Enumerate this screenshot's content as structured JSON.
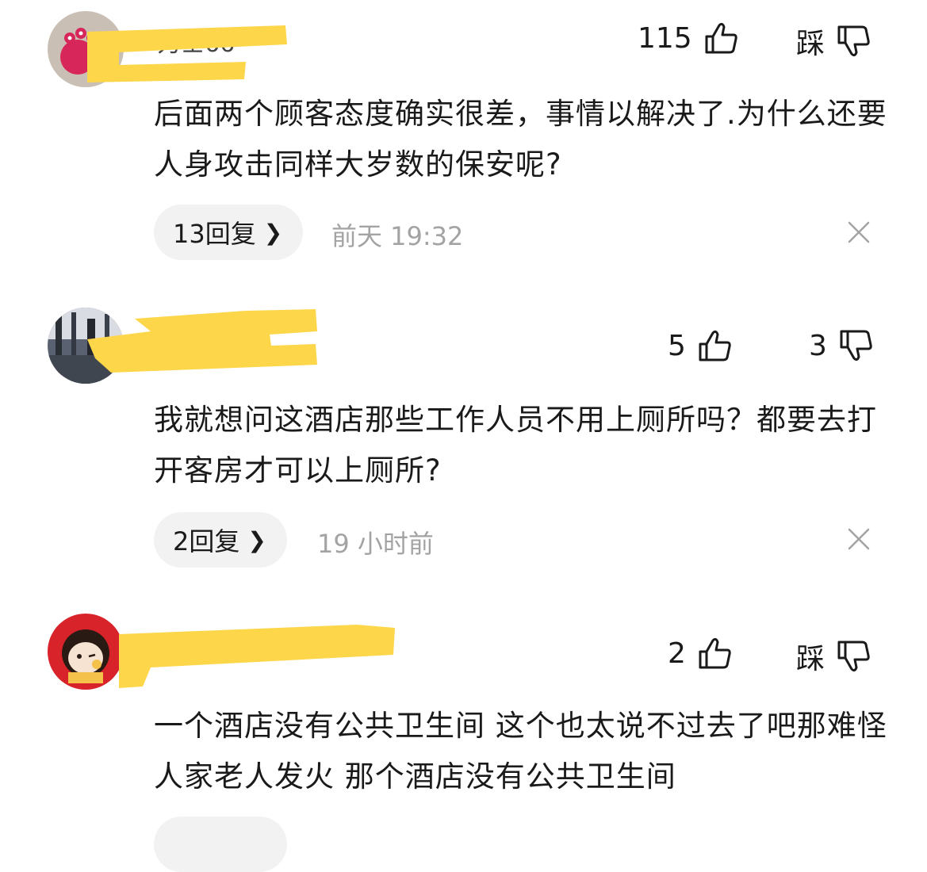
{
  "comments": [
    {
      "username": "力士66",
      "likes": "115",
      "dislike": "踩",
      "text": "后面两个顾客态度确实很差，事情以解决了.为什么还要人身攻击同样大岁数的保安呢?",
      "replies": "13回复",
      "time": "前天 19:32"
    },
    {
      "username": "",
      "likes": "5",
      "dislike": "3",
      "text": "我就想问这酒店那些工作人员不用上厕所吗？都要去打开客房才可以上厕所?",
      "replies": "2回复",
      "time": "19 小时前"
    },
    {
      "username": "",
      "likes": "2",
      "dislike": "踩",
      "text": "一个酒店没有公共卫生间 这个也太说不过去了吧那难怪人家老人发火 那个酒店没有公共卫生间"
    }
  ],
  "icons": {
    "like": "thumbs-up-icon",
    "dislike": "thumbs-down-icon",
    "chevron": "chevron-right-icon",
    "close": "close-icon"
  },
  "colors": {
    "redaction": "#fdd64a",
    "secondary_text": "#a3a3a3",
    "pill_bg": "#f2f2f2"
  }
}
